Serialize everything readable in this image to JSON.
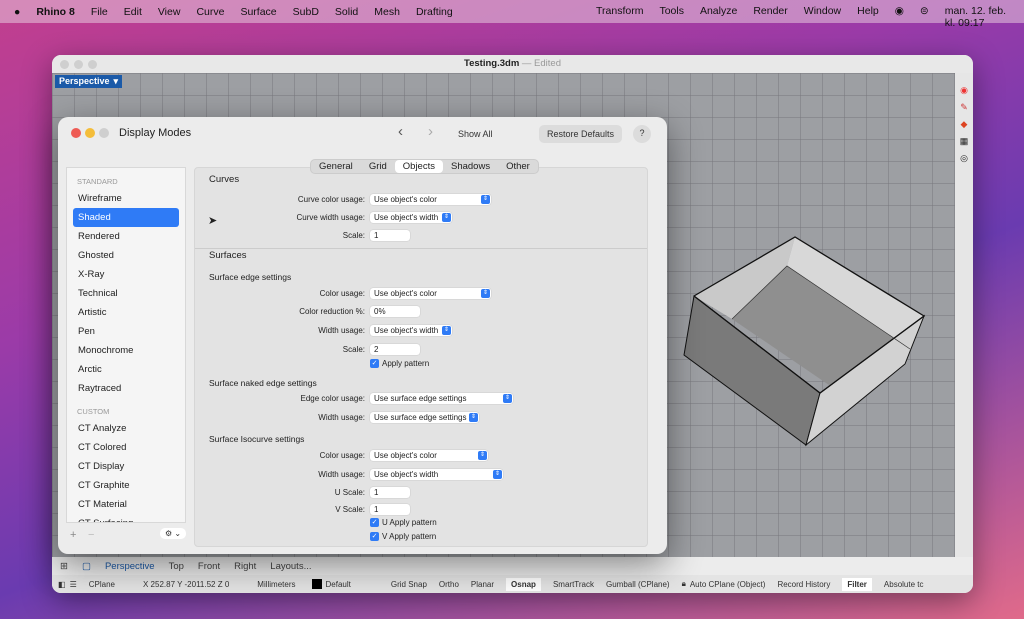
{
  "menubar": {
    "apple": "",
    "app": "Rhino 8",
    "items": [
      "File",
      "Edit",
      "View",
      "Curve",
      "Surface",
      "SubD",
      "Solid",
      "Mesh",
      "Drafting"
    ],
    "right_items": [
      "Transform",
      "Tools",
      "Analyze",
      "Render",
      "Window",
      "Help"
    ],
    "clock": "man. 12. feb. kl. 09:17"
  },
  "window": {
    "title": "Testing.3dm",
    "edited": "— Edited",
    "viewport_label": "Perspective"
  },
  "viewport_tabs": [
    "Perspective",
    "Top",
    "Front",
    "Right",
    "Layouts..."
  ],
  "status": {
    "cplane": "CPlane",
    "coords": "X 252.87 Y -2011.52 Z 0",
    "units": "Millimeters",
    "layer": "Default",
    "toggles": [
      "Grid Snap",
      "Ortho",
      "Planar",
      "Osnap",
      "SmartTrack",
      "Gumball (CPlane)",
      "Auto CPlane (Object)",
      "Record History",
      "Filter",
      "Absolute tc"
    ],
    "active": [
      "Osnap",
      "Filter"
    ]
  },
  "dialog": {
    "title": "Display Modes",
    "show_all": "Show All",
    "restore": "Restore Defaults",
    "help": "?",
    "standard_header": "STANDARD",
    "standard": [
      "Wireframe",
      "Shaded",
      "Rendered",
      "Ghosted",
      "X-Ray",
      "Technical",
      "Artistic",
      "Pen",
      "Monochrome",
      "Arctic",
      "Raytraced"
    ],
    "selected": "Shaded",
    "custom_header": "CUSTOM",
    "custom": [
      "CT Analyze",
      "CT Colored",
      "CT Display",
      "CT Graphite",
      "CT Material",
      "CT Surfacing"
    ],
    "tabs": [
      "General",
      "Grid",
      "Objects",
      "Shadows",
      "Other"
    ],
    "active_tab": "Objects",
    "curves": {
      "title": "Curves",
      "color_label": "Curve color usage:",
      "color": "Use object's color",
      "width_label": "Curve width usage:",
      "width": "Use object's width",
      "scale_label": "Scale:",
      "scale": "1"
    },
    "surfaces": {
      "title": "Surfaces",
      "edge_title": "Surface edge settings",
      "color_label": "Color usage:",
      "color": "Use object's color",
      "reduction_label": "Color reduction %:",
      "reduction": "0%",
      "width_label": "Width usage:",
      "width": "Use object's width",
      "scale_label": "Scale:",
      "scale": "2",
      "apply": "Apply pattern",
      "naked_title": "Surface naked edge settings",
      "naked_color_label": "Edge color usage:",
      "naked_color": "Use surface edge settings",
      "naked_width_label": "Width usage:",
      "naked_width": "Use surface edge settings",
      "iso_title": "Surface Isocurve settings",
      "iso_color_label": "Color usage:",
      "iso_color": "Use object's color",
      "iso_width_label": "Width usage:",
      "iso_width": "Use object's width",
      "u_label": "U Scale:",
      "u": "1",
      "v_label": "V Scale:",
      "v": "1",
      "u_apply": "U Apply pattern",
      "v_apply": "V Apply pattern"
    }
  }
}
